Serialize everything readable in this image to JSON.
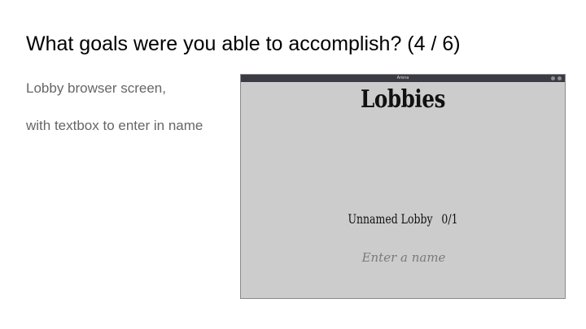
{
  "slide": {
    "title": "What goals were you able to accomplish? (4 / 6)",
    "lines": [
      "Lobby browser screen,",
      "with textbox to enter in name"
    ]
  },
  "game_window": {
    "window_title": "Arena",
    "heading": "Lobbies",
    "lobbies": [
      {
        "name": "Unnamed Lobby",
        "players": "0/1"
      }
    ],
    "name_input": {
      "placeholder": "Enter a name",
      "value": ""
    }
  },
  "colors": {
    "slide_background": "#ffffff",
    "title_text": "#000000",
    "body_text": "#666666",
    "game_background": "#cccccc",
    "titlebar": "#3b3b44"
  }
}
